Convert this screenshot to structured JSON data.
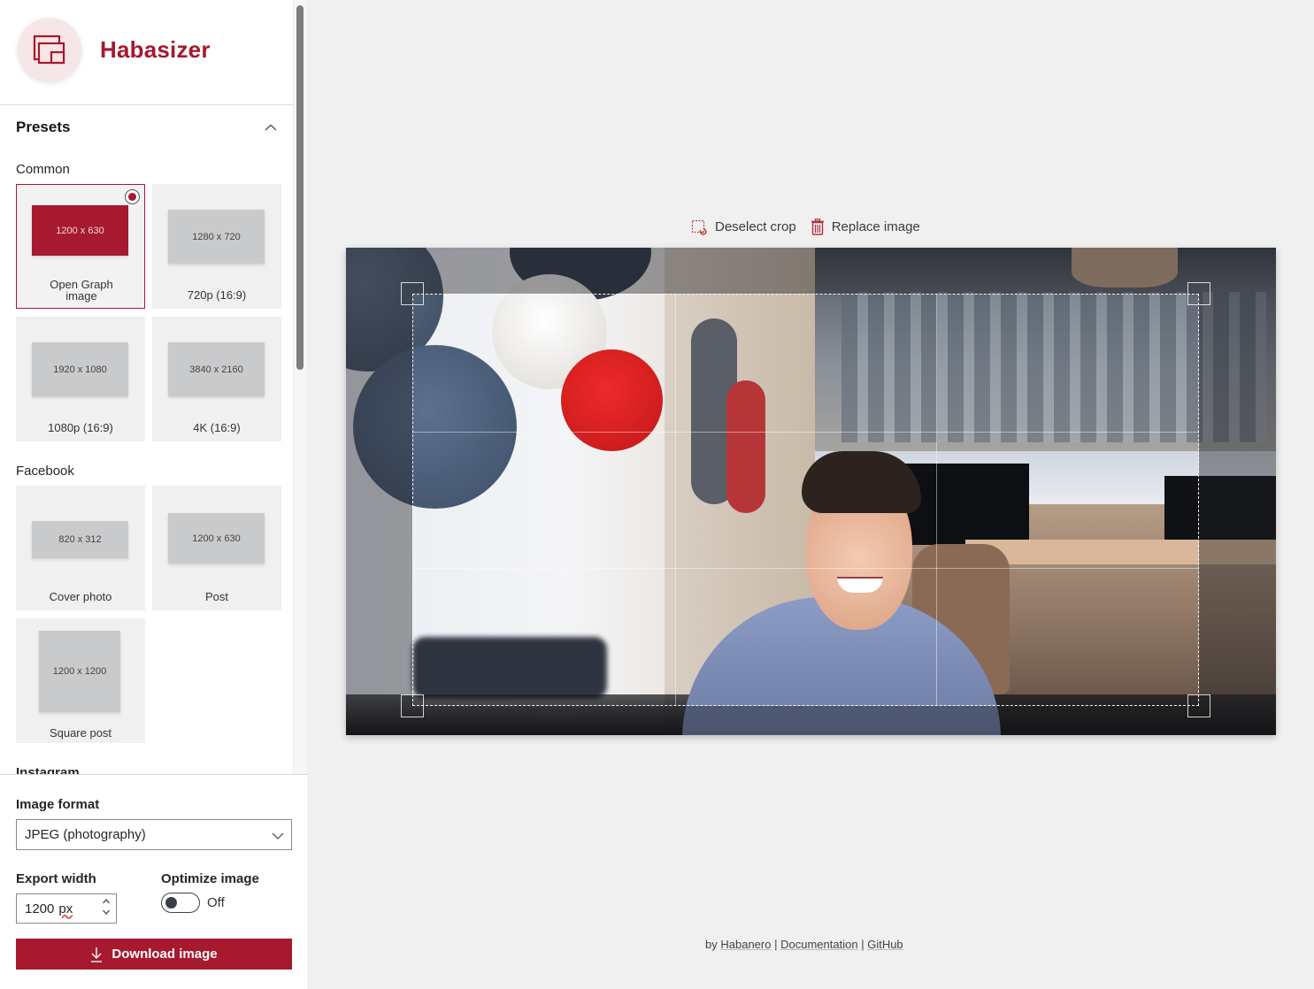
{
  "app": {
    "name": "Habasizer",
    "brand_color": "#a6192e"
  },
  "presets": {
    "title": "Presets",
    "collapse_icon": "chevron-up-icon",
    "groups": [
      {
        "title": "Common",
        "items": [
          {
            "size": "1200 x 630",
            "label": "Open Graph image",
            "selected": true
          },
          {
            "size": "1280 x 720",
            "label": "720p (16:9)",
            "selected": false
          },
          {
            "size": "1920 x 1080",
            "label": "1080p (16:9)",
            "selected": false
          },
          {
            "size": "3840 x 2160",
            "label": "4K (16:9)",
            "selected": false
          }
        ]
      },
      {
        "title": "Facebook",
        "items": [
          {
            "size": "820 x 312",
            "label": "Cover photo",
            "selected": false
          },
          {
            "size": "1200 x 630",
            "label": "Post",
            "selected": false
          },
          {
            "size": "1200 x 1200",
            "label": "Square post",
            "selected": false
          }
        ]
      },
      {
        "title": "Instagram",
        "items": []
      }
    ]
  },
  "export": {
    "format_label": "Image format",
    "format_value": "JPEG (photography)",
    "width_label": "Export width",
    "width_value": "1200",
    "width_unit": "px",
    "optimize_label": "Optimize image",
    "optimize_state": "Off",
    "optimize_on": false,
    "download_label": "Download image"
  },
  "toolbar": {
    "deselect_label": "Deselect crop",
    "replace_label": "Replace image"
  },
  "footer": {
    "by_prefix": "by",
    "habanero": "Habanero",
    "sep": "|",
    "documentation": "Documentation",
    "github": "GitHub"
  }
}
